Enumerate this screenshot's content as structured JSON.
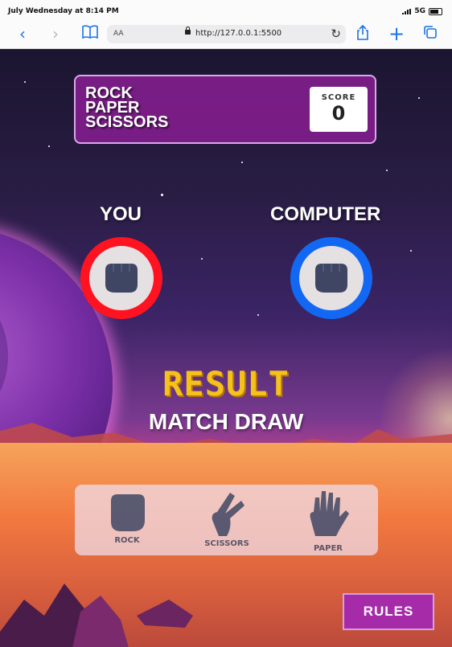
{
  "status_bar": {
    "time": "July Wednesday at 8:14 PM",
    "network": "5G"
  },
  "browser": {
    "text_size_label": "AA",
    "url": "http://127.0.0.1:5500",
    "icons": [
      "back-icon",
      "forward-icon",
      "bookmarks-icon",
      "lock-icon",
      "reload-icon",
      "share-icon",
      "new-tab-icon",
      "tabs-icon"
    ]
  },
  "game": {
    "title_lines": [
      "ROCK",
      "PAPER",
      "SCISSORS"
    ],
    "score_label": "SCORE",
    "score_value": "0",
    "you_label": "YOU",
    "computer_label": "COMPUTER",
    "you_choice_icon": "fist-icon",
    "computer_choice_icon": "fist-icon",
    "result_heading": "RESULT",
    "result_text": "MATCH DRAW",
    "choices": [
      {
        "label": "ROCK",
        "icon": "fist-icon"
      },
      {
        "label": "SCISSORS",
        "icon": "scissors-hand-icon"
      },
      {
        "label": "PAPER",
        "icon": "open-hand-icon"
      }
    ],
    "rules_label": "RULES"
  },
  "colors": {
    "player_ring": "#ff1320",
    "computer_ring": "#1268f2",
    "result_yellow": "#f5c21b",
    "header_purple": "#8c1e96",
    "hand_fill": "#3f4663"
  }
}
